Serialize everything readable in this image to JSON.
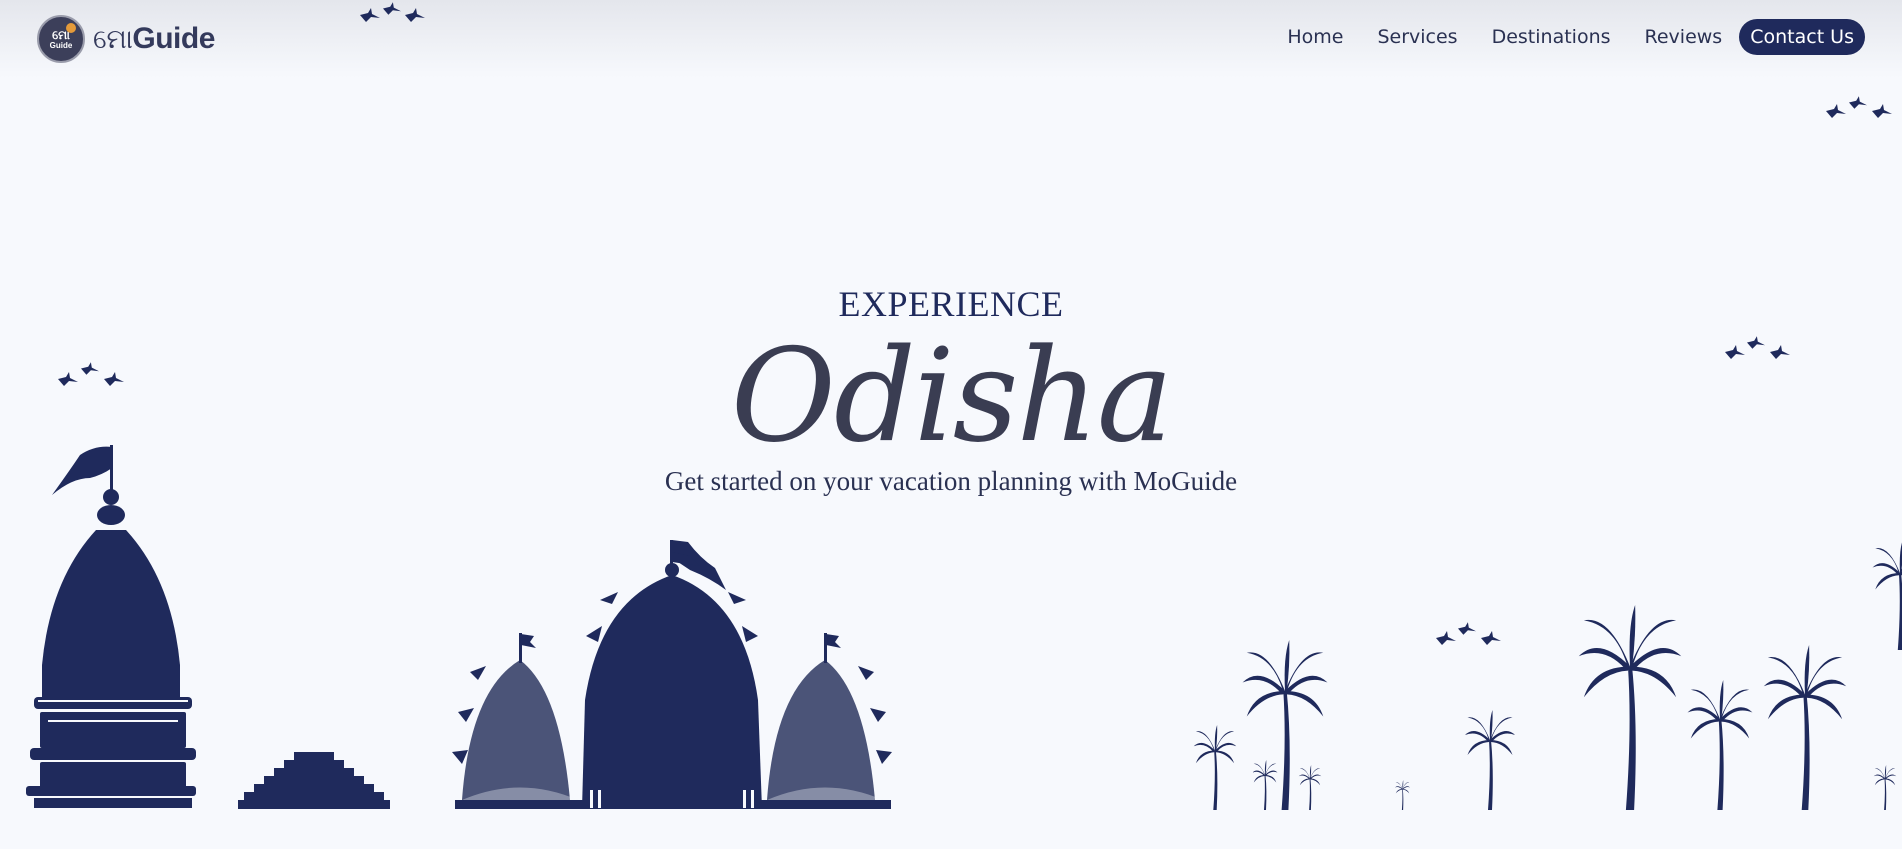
{
  "logo": {
    "badge_line1": "ମୋ",
    "badge_line2": "Guide",
    "text_prefix": "ମୋ",
    "text_main": "Guide"
  },
  "nav": {
    "items": [
      {
        "label": "Home"
      },
      {
        "label": "Services"
      },
      {
        "label": "Destinations"
      },
      {
        "label": "Reviews"
      }
    ],
    "contact_label": "Contact Us"
  },
  "hero": {
    "eyebrow": "EXPERIENCE",
    "headline": "Odisha",
    "subtitle": "Get started on your vacation planning with MoGuide"
  },
  "colors": {
    "navy": "#1f2a5c",
    "slate": "#4b5478",
    "background": "#f7f9fd"
  },
  "icons": [
    "bird-flock-icon",
    "temple-silhouette",
    "palm-tree-silhouette"
  ]
}
